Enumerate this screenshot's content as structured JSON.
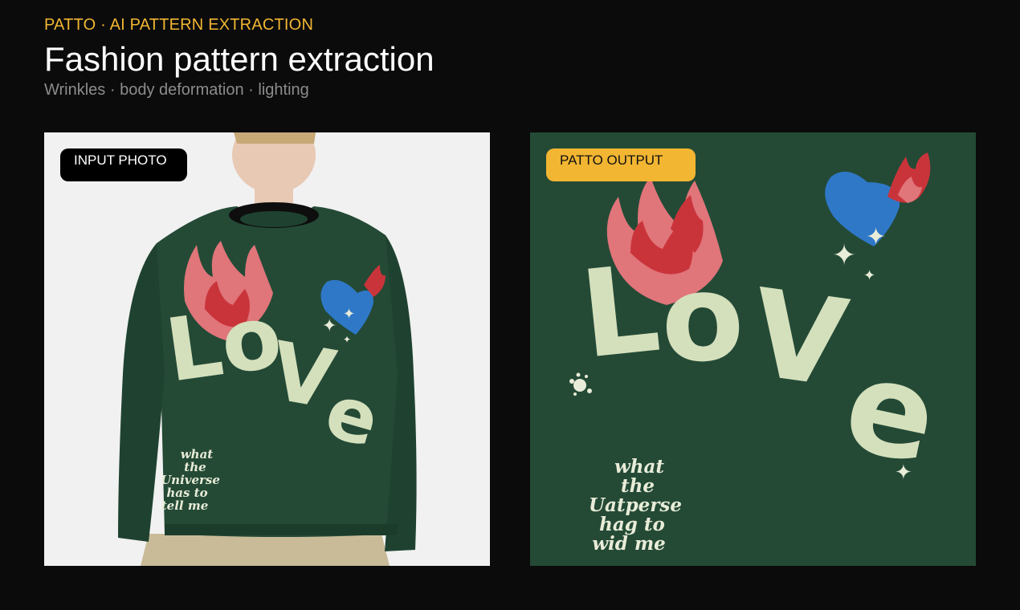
{
  "header": {
    "eyebrow": "PATTO · AI PATTERN EXTRACTION",
    "title": "Fashion pattern extraction",
    "subtitle": "Wrinkles · body deformation · lighting"
  },
  "panels": {
    "input": {
      "badge": "INPUT PHOTO",
      "print_text": [
        "what",
        "the",
        "Universe",
        "has to",
        "tell me"
      ]
    },
    "output": {
      "badge": "PATTO OUTPUT",
      "print_text": [
        "what",
        "the",
        "Uatperse",
        "hag to",
        "wid me"
      ]
    }
  },
  "colors": {
    "accent": "#f2b632",
    "sweater_green": "#244a36",
    "print_cream": "#d4e0bc",
    "flame_pink": "#e0757a",
    "flame_red": "#c9343a",
    "heart_blue": "#2f78c8"
  }
}
